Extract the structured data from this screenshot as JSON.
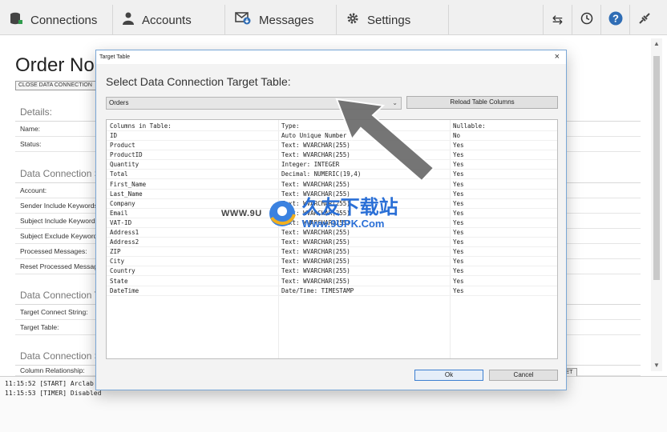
{
  "nav": {
    "tabs": [
      {
        "label": "Connections",
        "icon": "database-icon"
      },
      {
        "label": "Accounts",
        "icon": "user-icon"
      },
      {
        "label": "Messages",
        "icon": "envelope-icon"
      },
      {
        "label": "Settings",
        "icon": "gear-icon"
      }
    ],
    "tools": [
      "swap-icon",
      "clock-icon",
      "help-icon",
      "plug-icon"
    ]
  },
  "page": {
    "title": "Order No",
    "close_button": "CLOSE DATA CONNECTION",
    "sections": [
      {
        "heading": "Details:",
        "fields": [
          "Name:",
          "Status:"
        ]
      },
      {
        "heading": "Data Connection S",
        "fields": [
          "Account:",
          "Sender Include Keywords:",
          "Subject Include Keywords:",
          "Subject Exclude Keywords:",
          "Processed Messages:",
          "Reset Processed Messages"
        ]
      },
      {
        "heading": "Data Connection T",
        "fields": [
          "Target Connect String:",
          "Target Table:"
        ]
      },
      {
        "heading": "Data Connection S",
        "fields": [
          "Column Relationship:"
        ]
      }
    ],
    "reset_fragment": "ET"
  },
  "log": {
    "lines": [
      "11:15:52 [START] Arclab",
      "11:15:53 [TIMER] Disabled"
    ]
  },
  "dialog": {
    "window_title": "Target Table",
    "heading": "Select Data Connection Target Table:",
    "table_value": "Orders",
    "reload_label": "Reload Table Columns",
    "columns_header": {
      "name": "Columns in Table:",
      "type": "Type:",
      "nullable": "Nullable:"
    },
    "rows": [
      {
        "name": "ID",
        "type": "Auto Unique Number",
        "nullable": "No"
      },
      {
        "name": "Product",
        "type": "Text: WVARCHAR(255)",
        "nullable": "Yes"
      },
      {
        "name": "ProductID",
        "type": "Text: WVARCHAR(255)",
        "nullable": "Yes"
      },
      {
        "name": "Quantity",
        "type": "Integer: INTEGER",
        "nullable": "Yes"
      },
      {
        "name": "Total",
        "type": "Decimal: NUMERIC(19,4)",
        "nullable": "Yes"
      },
      {
        "name": "First_Name",
        "type": "Text: WVARCHAR(255)",
        "nullable": "Yes"
      },
      {
        "name": "Last_Name",
        "type": "Text: WVARCHAR(255)",
        "nullable": "Yes"
      },
      {
        "name": "Company",
        "type": "Text: WVARCHAR(255)",
        "nullable": "Yes"
      },
      {
        "name": "Email",
        "type": "Text: WVARCHAR(255)",
        "nullable": "Yes"
      },
      {
        "name": "VAT-ID",
        "type": "Text: WVARCHAR(255)",
        "nullable": "Yes"
      },
      {
        "name": "Address1",
        "type": "Text: WVARCHAR(255)",
        "nullable": "Yes"
      },
      {
        "name": "Address2",
        "type": "Text: WVARCHAR(255)",
        "nullable": "Yes"
      },
      {
        "name": "ZIP",
        "type": "Text: WVARCHAR(255)",
        "nullable": "Yes"
      },
      {
        "name": "City",
        "type": "Text: WVARCHAR(255)",
        "nullable": "Yes"
      },
      {
        "name": "Country",
        "type": "Text: WVARCHAR(255)",
        "nullable": "Yes"
      },
      {
        "name": "State",
        "type": "Text: WVARCHAR(255)",
        "nullable": "Yes"
      },
      {
        "name": "DateTime",
        "type": "Date/Time: TIMESTAMP",
        "nullable": "Yes"
      }
    ],
    "ok_label": "Ok",
    "cancel_label": "Cancel",
    "close_glyph": "×"
  },
  "watermark": {
    "left_text": "WWW.9U",
    "cn_text": "久友下载站",
    "url_text": "Www.9UPK.Com"
  },
  "colors": {
    "accent": "#3c7fd1",
    "help": "#2f6db5",
    "watermark": "#2a6fd6"
  }
}
